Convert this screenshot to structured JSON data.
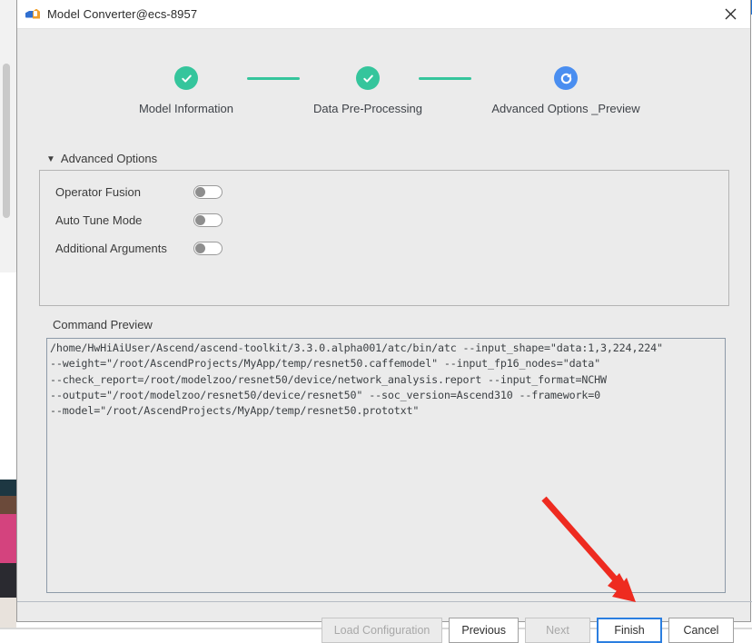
{
  "window": {
    "title": "Model Converter@ecs-8957",
    "app_icon": "model-converter-icon",
    "close_icon": "close-icon"
  },
  "stepper": {
    "steps": [
      {
        "label": "Model Information",
        "state": "done",
        "icon": "check-circle-icon"
      },
      {
        "label": "Data Pre-Processing",
        "state": "done",
        "icon": "check-circle-icon"
      },
      {
        "label": "Advanced Options _Preview",
        "state": "active",
        "icon": "refresh-circle-icon"
      }
    ],
    "done_color": "#35c59c",
    "active_color": "#4a8ef0",
    "connector_color": "#35c59c"
  },
  "advanced_options": {
    "section_title": "Advanced Options",
    "caret": "▼",
    "expanded": true,
    "options": [
      {
        "label": "Operator Fusion",
        "enabled": false
      },
      {
        "label": "Auto Tune Mode",
        "enabled": false
      },
      {
        "label": "Additional Arguments",
        "enabled": false
      }
    ]
  },
  "command_preview": {
    "label": "Command Preview",
    "lines": [
      "/home/HwHiAiUser/Ascend/ascend-toolkit/3.3.0.alpha001/atc/bin/atc --input_shape=\"data:1,3,224,224\"",
      "--weight=\"/root/AscendProjects/MyApp/temp/resnet50.caffemodel\" --input_fp16_nodes=\"data\"",
      "--check_report=/root/modelzoo/resnet50/device/network_analysis.report --input_format=NCHW",
      "--output=\"/root/modelzoo/resnet50/device/resnet50\" --soc_version=Ascend310 --framework=0",
      "--model=\"/root/AscendProjects/MyApp/temp/resnet50.prototxt\""
    ]
  },
  "footer": {
    "buttons": [
      {
        "label": "Load Configuration",
        "state": "disabled"
      },
      {
        "label": "Previous",
        "state": "normal"
      },
      {
        "label": "Next",
        "state": "disabled"
      },
      {
        "label": "Finish",
        "state": "focused"
      },
      {
        "label": "Cancel",
        "state": "normal"
      }
    ]
  },
  "annotation": {
    "arrow_color": "#ee2b20",
    "points_to": "Finish"
  }
}
